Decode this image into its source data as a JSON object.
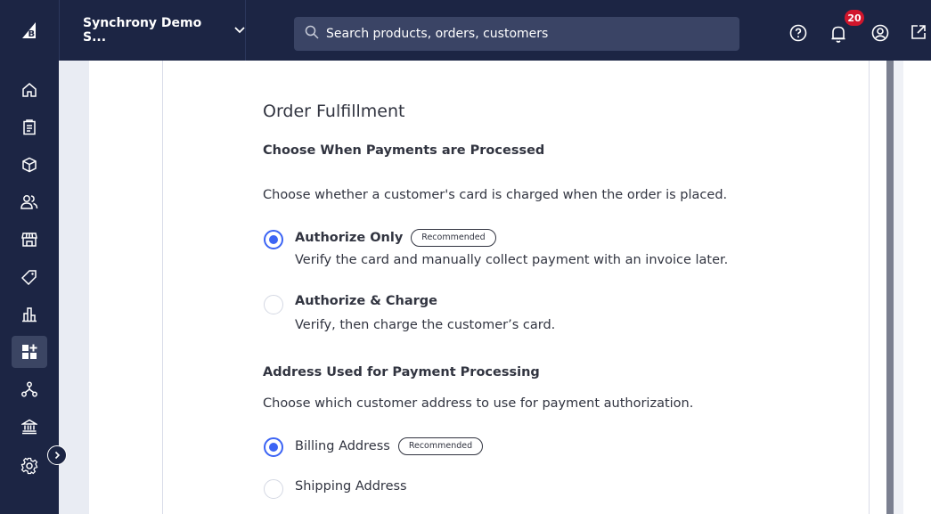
{
  "header": {
    "store_name": "Synchrony Demo S...",
    "search_placeholder": "Search products, orders, customers",
    "notification_count": "20"
  },
  "icons": {
    "logo": "bigcommerce-logo",
    "help": "help-icon",
    "notifications": "bell-icon",
    "account": "user-circle-icon",
    "external": "external-link-icon",
    "sidebar": [
      "home-icon",
      "orders-icon",
      "products-icon",
      "customers-icon",
      "storefront-icon",
      "marketing-icon",
      "analytics-icon",
      "apps-icon",
      "channels-icon",
      "payments-icon",
      "settings-icon"
    ]
  },
  "colors": {
    "nav_bg": "#1c2544",
    "accent": "#3c64f4",
    "badge": "#d1162c"
  },
  "content": {
    "title": "Order Fulfillment",
    "section1": {
      "heading": "Choose When Payments are Processed",
      "description": "Choose whether a customer's card is charged when the order is placed.",
      "options": [
        {
          "label": "Authorize Only",
          "badge": "Recommended",
          "description": "Verify the card and manually collect payment with an invoice later.",
          "selected": true
        },
        {
          "label": "Authorize & Charge",
          "description": "Verify, then charge the customer’s card.",
          "selected": false
        }
      ]
    },
    "section2": {
      "heading": "Address Used for Payment Processing",
      "description": "Choose which customer address to use for payment authorization.",
      "options": [
        {
          "label": "Billing Address",
          "badge": "Recommended",
          "selected": true
        },
        {
          "label": "Shipping Address",
          "selected": false
        }
      ]
    }
  }
}
